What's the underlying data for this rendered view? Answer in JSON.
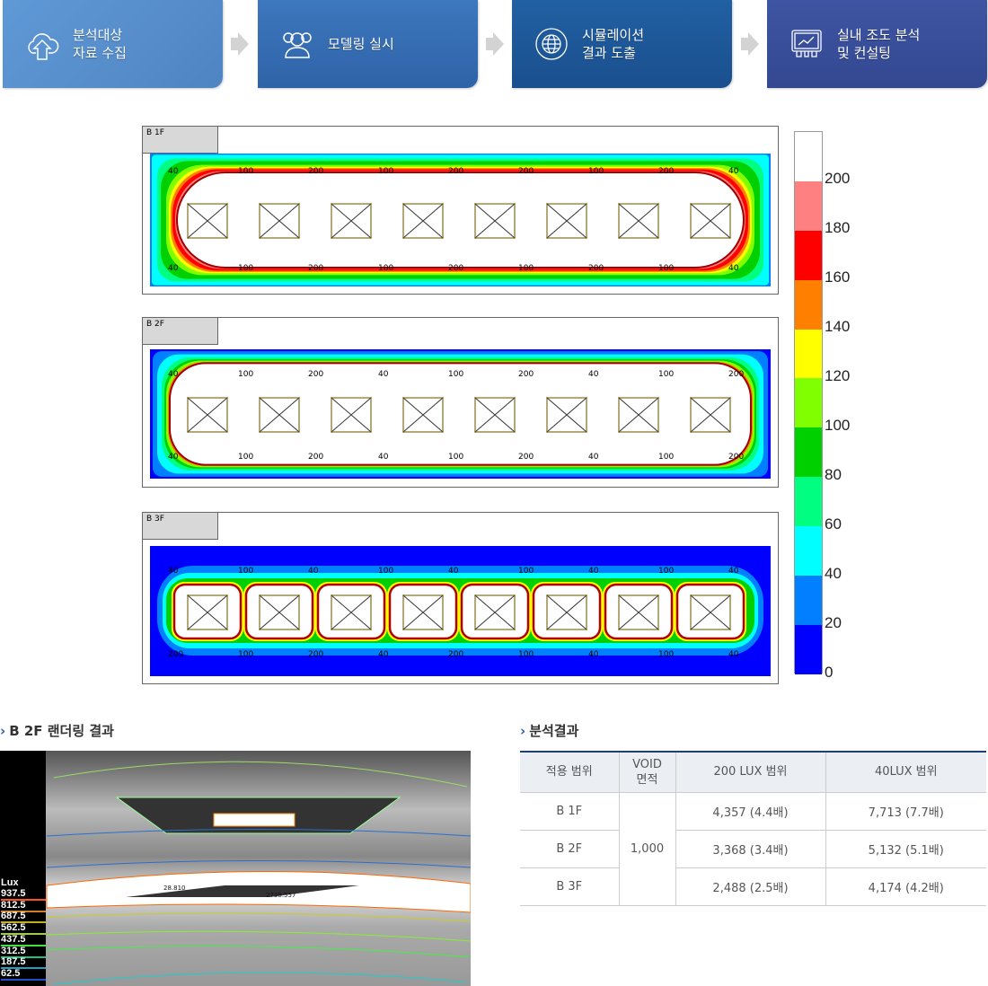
{
  "steps": [
    {
      "label": "분석대상\n자료 수집",
      "icon": "cloud-upload-icon",
      "color": "#5a92d0"
    },
    {
      "label": "모델링 실시",
      "icon": "users-icon",
      "color": "#3a70b5"
    },
    {
      "label": "시뮬레이션\n결과 도출",
      "icon": "globe-icon",
      "color": "#1f5a9c"
    },
    {
      "label": "실내 조도 분석\n및 컨설팅",
      "icon": "chart-monitor-icon",
      "color": "#3a4f9b"
    }
  ],
  "floors": [
    {
      "name": "B 1F",
      "labels": [
        "40",
        "100",
        "200",
        "100",
        "200",
        "200",
        "100",
        "200",
        "40",
        "40",
        "100",
        "200",
        "100",
        "200",
        "100",
        "200",
        "100",
        "40"
      ]
    },
    {
      "name": "B 2F",
      "labels": [
        "40",
        "100",
        "200",
        "40",
        "100",
        "200",
        "40",
        "100",
        "200",
        "40",
        "100",
        "200",
        "40",
        "100",
        "200",
        "40",
        "100",
        "200"
      ]
    },
    {
      "name": "B 3F",
      "labels": [
        "40",
        "100",
        "40",
        "100",
        "40",
        "100",
        "40",
        "100",
        "40",
        "200",
        "100",
        "200",
        "40",
        "200",
        "100",
        "40",
        "100",
        "40"
      ]
    }
  ],
  "scale": {
    "labels": [
      "200",
      "180",
      "160",
      "140",
      "120",
      "100",
      "80",
      "60",
      "40",
      "20",
      "0"
    ],
    "colors": [
      "#ffffff",
      "#ff8080",
      "#ff0000",
      "#ff8000",
      "#ffff00",
      "#80ff00",
      "#00d000",
      "#00ff80",
      "#00ffff",
      "#0080ff",
      "#0000ff"
    ]
  },
  "render": {
    "title": "B 2F 랜더링 결과",
    "legend_title": "Lux",
    "legend": [
      {
        "v": "937.5",
        "c": "#ff5020"
      },
      {
        "v": "812.5",
        "c": "#d08020"
      },
      {
        "v": "687.5",
        "c": "#c0b020"
      },
      {
        "v": "562.5",
        "c": "#a0d020"
      },
      {
        "v": "437.5",
        "c": "#40e040"
      },
      {
        "v": "312.5",
        "c": "#20c080"
      },
      {
        "v": "187.5",
        "c": "#20a0c0"
      },
      {
        "v": "62.5",
        "c": "#2050d0"
      }
    ],
    "value_a": "28.810",
    "value_b": "2738.557"
  },
  "results": {
    "title": "분석결과",
    "headers": [
      "적용 범위",
      "VOID\n면적",
      "200 LUX 범위",
      "40LUX 범위"
    ],
    "void_area": "1,000",
    "rows": [
      [
        "B 1F",
        "4,357 (4.4배)",
        "7,713 (7.7배)"
      ],
      [
        "B 2F",
        "3,368 (3.4배)",
        "5,132 (5.1배)"
      ],
      [
        "B 3F",
        "2,488 (2.5배)",
        "4,174 (4.2배)"
      ]
    ]
  }
}
